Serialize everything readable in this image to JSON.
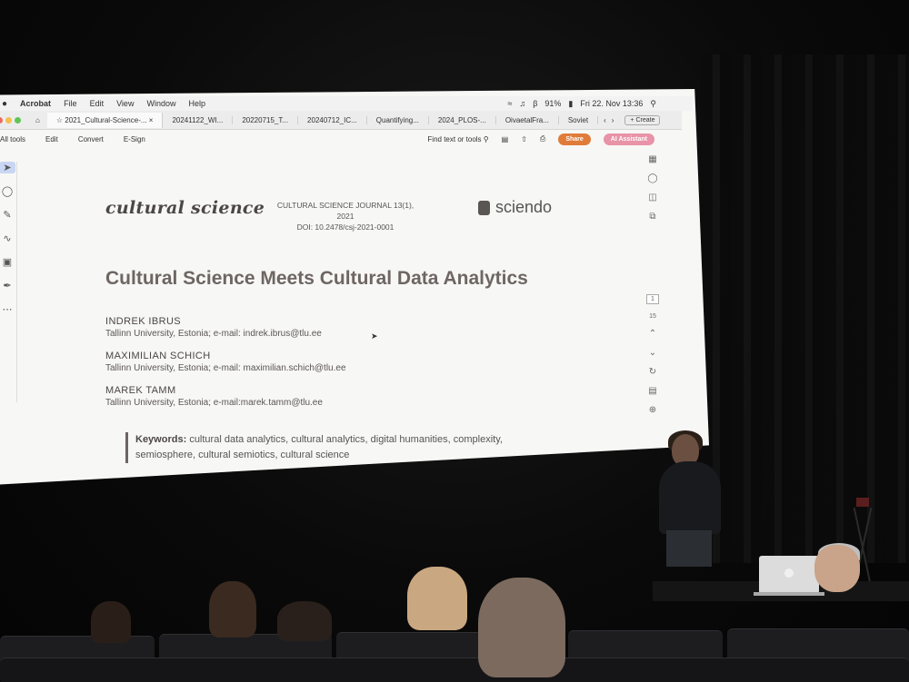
{
  "menubar": {
    "apple": "",
    "app": "Acrobat",
    "items": [
      "File",
      "Edit",
      "View",
      "Window",
      "Help"
    ],
    "battery": "91%",
    "datetime": "Fri 22. Nov 13:36"
  },
  "tabs": {
    "items": [
      "2021_Cultural-Science-...",
      "20241122_WI...",
      "20220715_T...",
      "20240712_IC...",
      "Quantifying...",
      "2024_PLOS-...",
      "OivaetalFra...",
      "Soviet"
    ],
    "create": "Create"
  },
  "toolbar": {
    "all_tools": "All tools",
    "edit": "Edit",
    "convert": "Convert",
    "esign": "E-Sign",
    "find": "Find text or tools",
    "share": "Share",
    "ai": "AI Assistant"
  },
  "pager": {
    "current": "1",
    "total": "15"
  },
  "document": {
    "journal_logo": "cultural science",
    "journal_info_line1": "CULTURAL SCIENCE JOURNAL 13(1), 2021",
    "journal_info_line2": "DOI: 10.2478/csj-2021-0001",
    "publisher": "sciendo",
    "title": "Cultural Science Meets Cultural Data Analytics",
    "authors": [
      {
        "name": "INDREK IBRUS",
        "affiliation": "Tallinn University, Estonia; e-mail: indrek.ibrus@tlu.ee"
      },
      {
        "name": "MAXIMILIAN SCHICH",
        "affiliation": "Tallinn University, Estonia; e-mail: maximilian.schich@tlu.ee"
      },
      {
        "name": "MAREK TAMM",
        "affiliation": "Tallinn University, Estonia; e-mail:marek.tamm@tlu.ee"
      }
    ],
    "keywords_label": "Keywords:",
    "keywords_text": "cultural data analytics, cultural analytics, digital humanities, complexity, semiosphere, cultural semiotics, cultural science"
  }
}
